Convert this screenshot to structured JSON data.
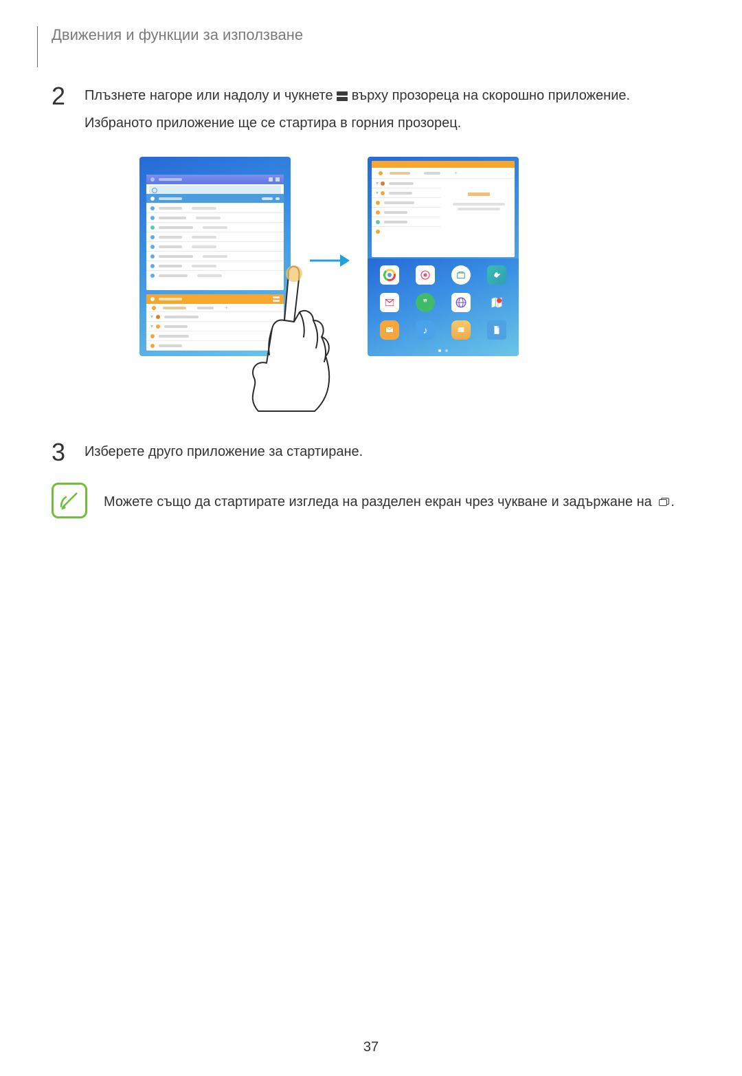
{
  "section_title": "Движения и функции за използване",
  "step2": {
    "number": "2",
    "line1_a": "Плъзнете нагоре или надолу и чукнете ",
    "line1_b": " върху прозореца на скорошно приложение.",
    "line2": "Избраното приложение ще се стартира в горния прозорец."
  },
  "step3": {
    "number": "3",
    "text": "Изберете друго приложение за стартиране."
  },
  "note": {
    "text_a": "Можете също да стартирате изгледа на разделен екран чрез чукване и задържане на ",
    "text_b": "."
  },
  "page_number": "37"
}
